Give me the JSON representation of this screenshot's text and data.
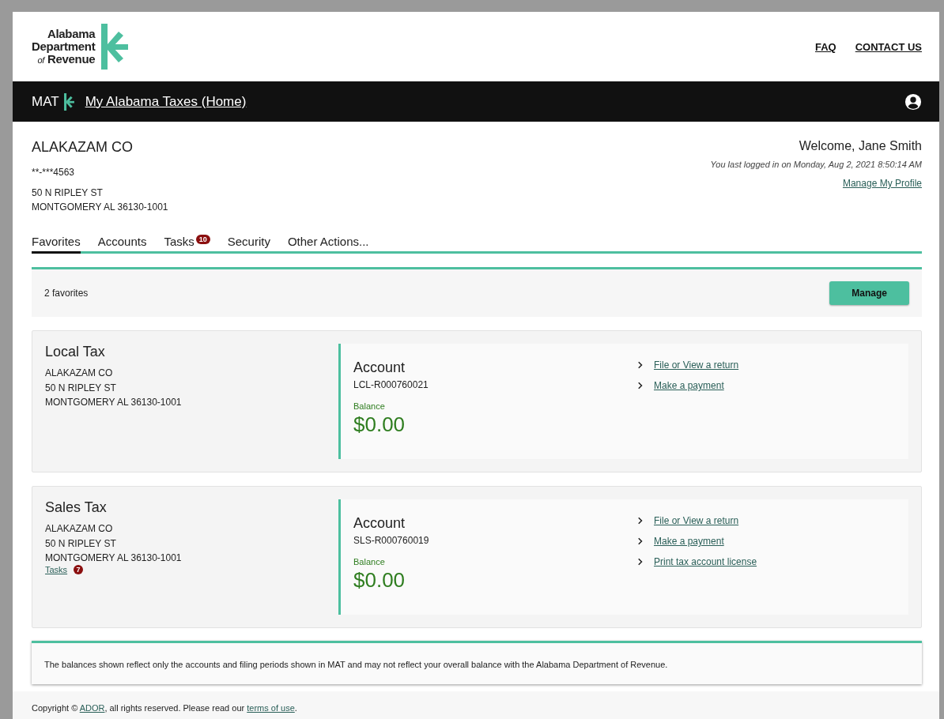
{
  "header": {
    "logo_lines": [
      "Alabama",
      "Department"
    ],
    "logo_of": "of",
    "logo_last": "Revenue",
    "links": [
      "FAQ",
      "CONTACT US"
    ]
  },
  "navbar": {
    "brand": "MAT",
    "home_link": "My Alabama Taxes (Home)"
  },
  "account": {
    "name": "ALAKAZAM CO",
    "id": "**-***4563",
    "address": [
      "50 N RIPLEY ST",
      "MONTGOMERY AL 36130-1001"
    ]
  },
  "welcome": {
    "greeting": "Welcome, Jane Smith",
    "last_login": "You last logged in on Monday, Aug 2, 2021 8:50:14 AM",
    "profile_link": "Manage My Profile"
  },
  "tabs": [
    {
      "label": "Favorites",
      "selected": true
    },
    {
      "label": "Accounts",
      "selected": false
    },
    {
      "label": "Tasks",
      "selected": false,
      "badge": "10"
    },
    {
      "label": "Security",
      "selected": false
    },
    {
      "label": "Other Actions...",
      "selected": false
    }
  ],
  "favorites_bar": {
    "count": "2 favorites",
    "button": "Manage"
  },
  "cards": [
    {
      "title": "Local Tax",
      "lines": [
        "ALAKAZAM CO",
        "50 N RIPLEY ST",
        "MONTGOMERY AL 36130-1001"
      ],
      "account_label": "Account",
      "account_number": "LCL-R000760021",
      "balance_label": "Balance",
      "balance": "$0.00",
      "actions": [
        "File or View a return",
        "Make a payment"
      ]
    },
    {
      "title": "Sales Tax",
      "lines": [
        "ALAKAZAM CO",
        "50 N RIPLEY ST",
        "MONTGOMERY AL 36130-1001"
      ],
      "tasks_link": "Tasks",
      "tasks_badge": "7",
      "account_label": "Account",
      "account_number": "SLS-R000760019",
      "balance_label": "Balance",
      "balance": "$0.00",
      "actions": [
        "File or View a return",
        "Make a payment",
        "Print tax account license"
      ]
    }
  ],
  "notice": "The balances shown reflect only the accounts and filing periods shown in MAT and may not reflect your overall balance with the Alabama Department of Revenue.",
  "footer": {
    "before": "Copyright © ",
    "link": "ADOR",
    "middle": ", all rights reserved. Please read our ",
    "terms_link": "terms of use",
    "after": "."
  }
}
